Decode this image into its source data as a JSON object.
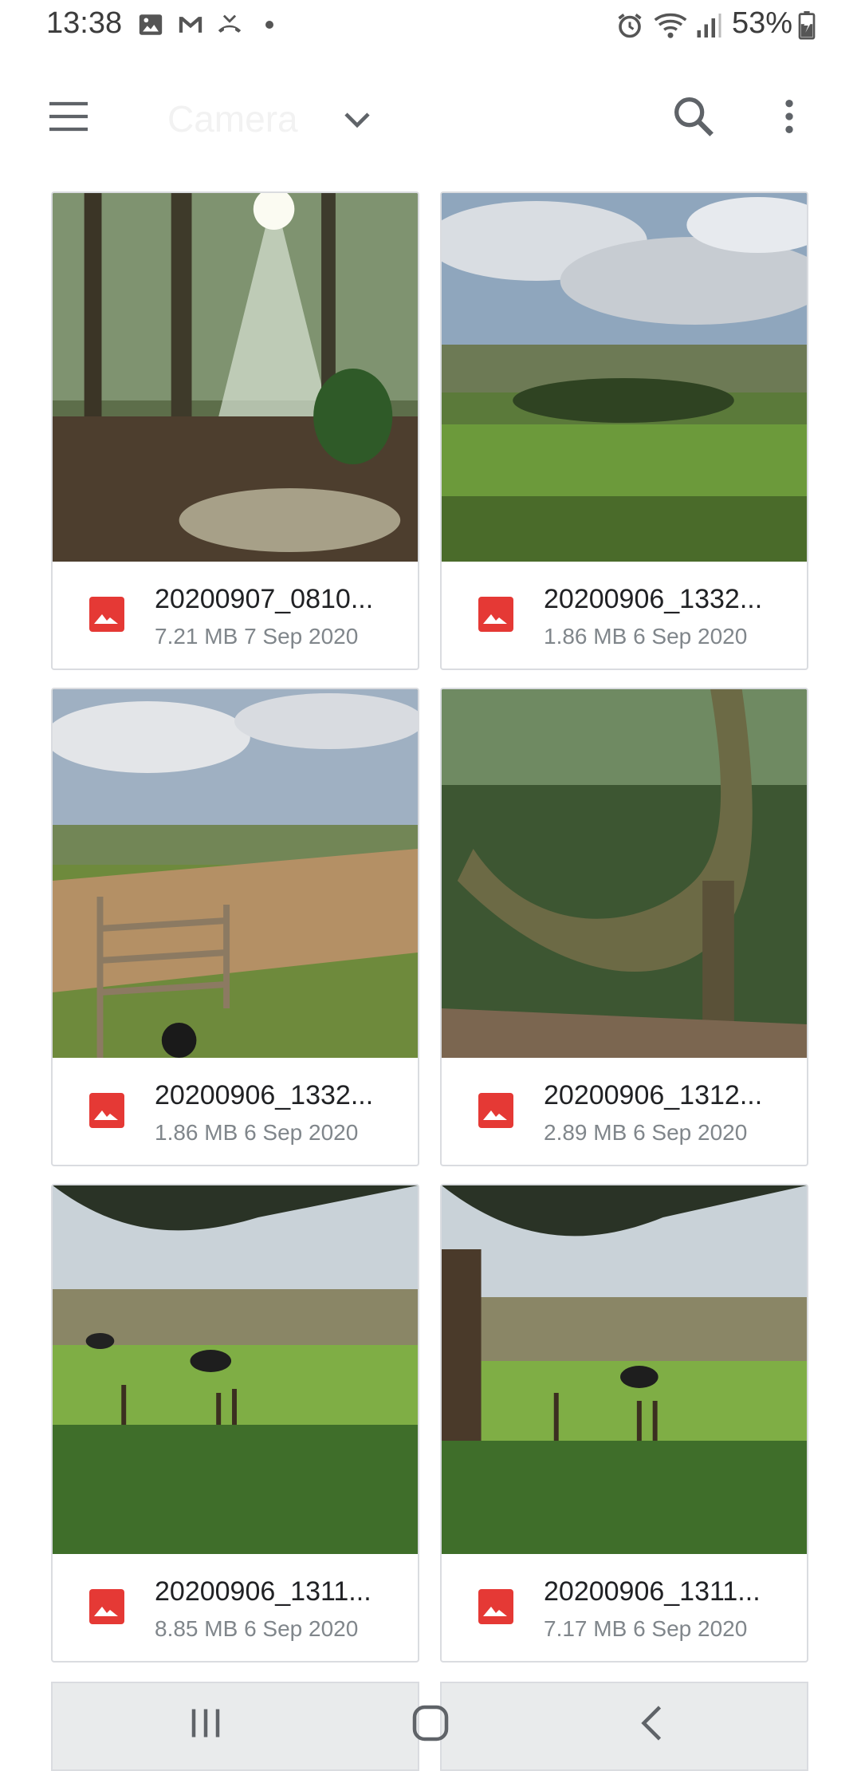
{
  "status_bar": {
    "time": "13:38",
    "battery": "53%",
    "icons": [
      "gallery-notification-icon",
      "gmail-notification-icon",
      "missed-call-icon",
      "dot-icon",
      "alarm-icon",
      "wifi-icon",
      "signal-icon",
      "battery-icon"
    ]
  },
  "app_bar": {
    "title": "Camera",
    "menu_icon": "menu-icon",
    "dropdown_icon": "chevron-down-icon",
    "search_icon": "search-icon",
    "more_icon": "more-vert-icon"
  },
  "files": [
    {
      "name": "20200907_0810...",
      "size": "7.21 MB",
      "date": "7 Sep 2020",
      "type_icon": "image-icon",
      "icon_color": "#e53935"
    },
    {
      "name": "20200906_1332...",
      "size": "1.86 MB",
      "date": "6 Sep 2020",
      "type_icon": "image-icon",
      "icon_color": "#e53935"
    },
    {
      "name": "20200906_1332...",
      "size": "1.86 MB",
      "date": "6 Sep 2020",
      "type_icon": "image-icon",
      "icon_color": "#e53935"
    },
    {
      "name": "20200906_1312...",
      "size": "2.89 MB",
      "date": "6 Sep 2020",
      "type_icon": "image-icon",
      "icon_color": "#e53935"
    },
    {
      "name": "20200906_1311...",
      "size": "8.85 MB",
      "date": "6 Sep 2020",
      "type_icon": "image-icon",
      "icon_color": "#e53935"
    },
    {
      "name": "20200906_1311...",
      "size": "7.17 MB",
      "date": "6 Sep 2020",
      "type_icon": "image-icon",
      "icon_color": "#e53935"
    }
  ],
  "nav_bar": {
    "recents_icon": "recents-icon",
    "home_icon": "home-icon",
    "back_icon": "back-icon"
  }
}
